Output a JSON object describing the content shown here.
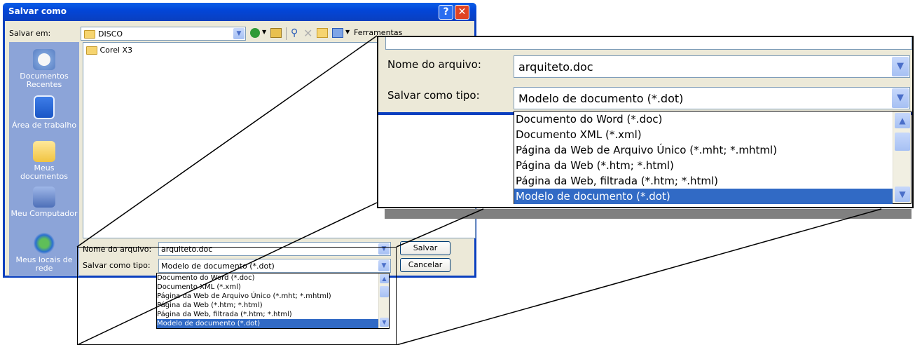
{
  "dialog": {
    "title": "Salvar como",
    "help_glyph": "?",
    "close_glyph": "✕",
    "save_in_label": "Salvar em:",
    "location": "DISCO",
    "toolbar_fragment": "Ferramentas"
  },
  "places": [
    {
      "label": "Documentos Recentes",
      "icon": "recent-documents-icon"
    },
    {
      "label": "Área de trabalho",
      "icon": "desktop-icon"
    },
    {
      "label": "Meus documentos",
      "icon": "my-documents-icon"
    },
    {
      "label": "Meu Computador",
      "icon": "my-computer-icon"
    },
    {
      "label": "Meus locais de rede",
      "icon": "network-places-icon"
    }
  ],
  "files": [
    "Corel X3"
  ],
  "form": {
    "filename_label": "Nome do arquivo:",
    "filename_value": "arquiteto.doc",
    "filetype_label": "Salvar como tipo:",
    "filetype_value": "Modelo de documento (*.dot)",
    "save_button": "Salvar",
    "cancel_button": "Cancelar"
  },
  "filetype_options": [
    "Documento do Word (*.doc)",
    "Documento XML (*.xml)",
    "Página da Web de Arquivo Único (*.mht; *.mhtml)",
    "Página da Web (*.htm; *.html)",
    "Página da Web, filtrada (*.htm; *.html)",
    "Modelo de documento (*.dot)"
  ],
  "selected_option_index": 5,
  "colors": {
    "titlebar": "#0a3fbf",
    "selection": "#316ac5",
    "places_bar": "#8ca4d8",
    "dialog_face": "#ece9d8"
  }
}
